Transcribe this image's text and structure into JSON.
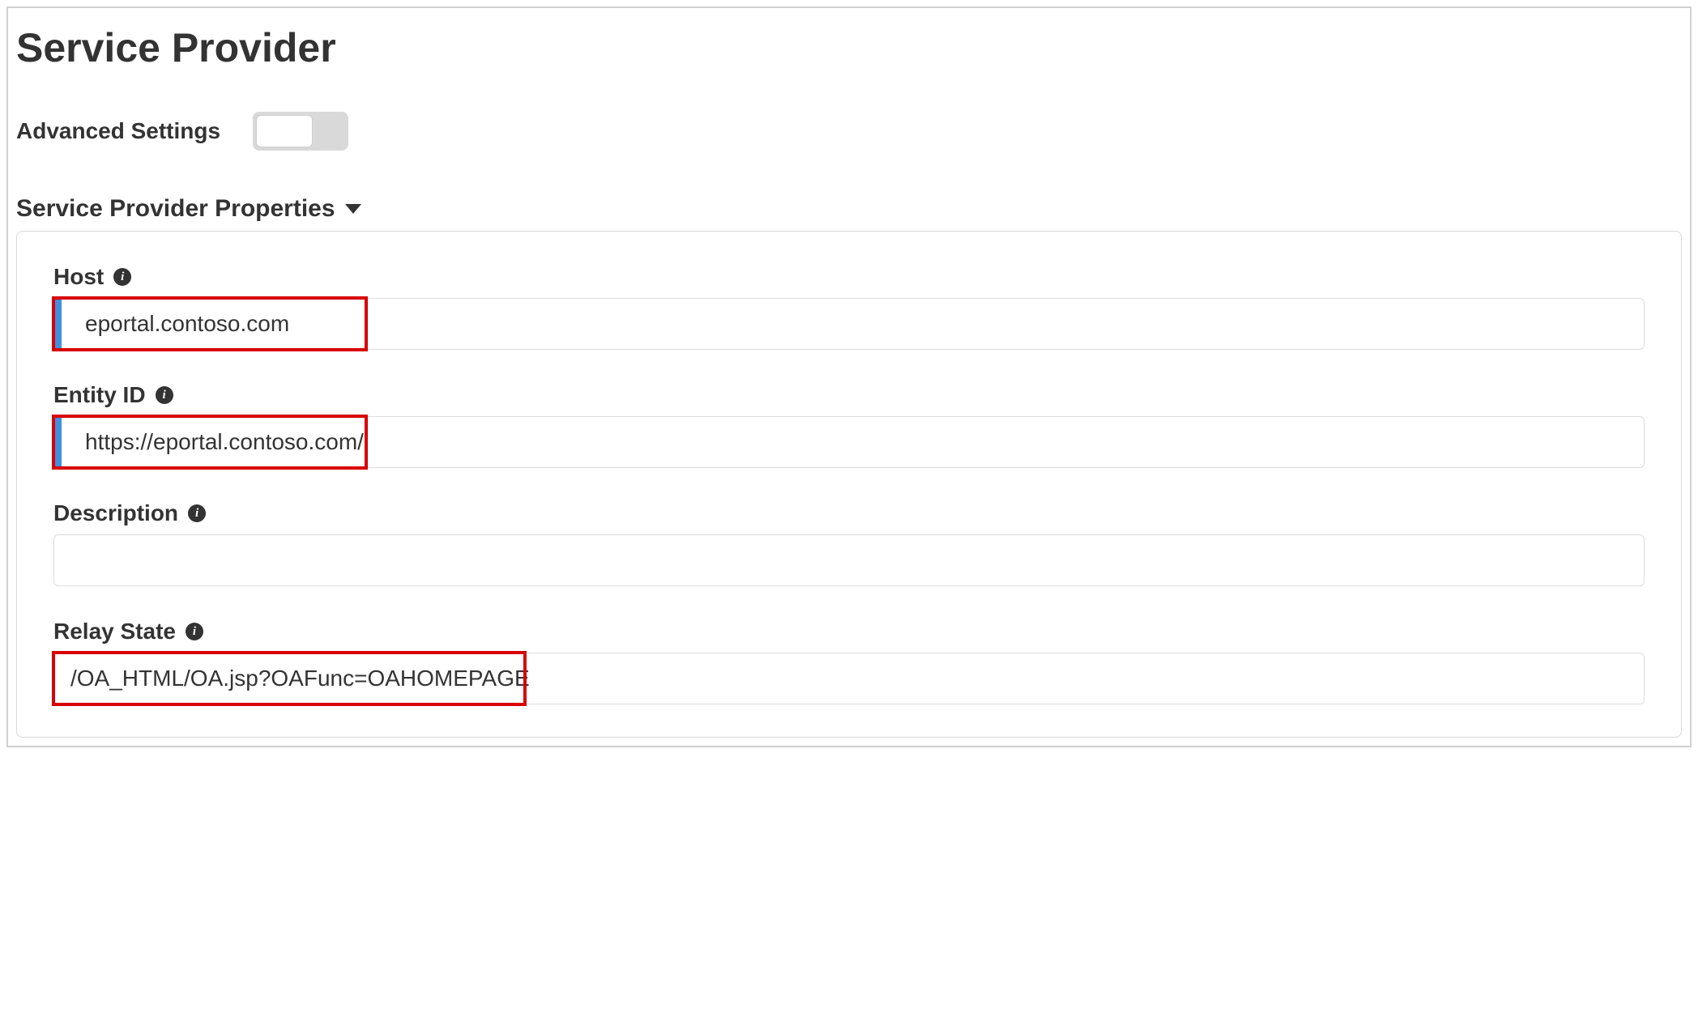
{
  "page": {
    "title": "Service Provider"
  },
  "advanced": {
    "label": "Advanced Settings",
    "on": false
  },
  "section": {
    "title": "Service Provider Properties"
  },
  "fields": {
    "host": {
      "label": "Host",
      "value": "eportal.contoso.com"
    },
    "entity_id": {
      "label": "Entity ID",
      "value": "https://eportal.contoso.com/"
    },
    "description": {
      "label": "Description",
      "value": ""
    },
    "relay_state": {
      "label": "Relay State",
      "value": "/OA_HTML/OA.jsp?OAFunc=OAHOMEPAGE"
    }
  },
  "icons": {
    "info_glyph": "i"
  }
}
